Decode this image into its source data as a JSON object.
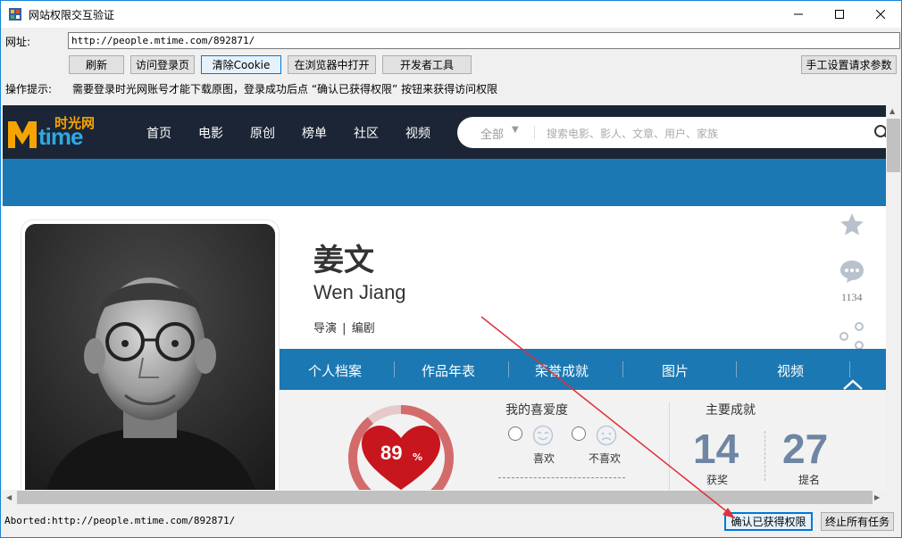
{
  "window": {
    "title": "网站权限交互验证",
    "minimize_icon": "minimize-icon",
    "maximize_icon": "maximize-icon",
    "close_icon": "close-icon"
  },
  "address": {
    "label": "网址:",
    "value": "http://people.mtime.com/892871/"
  },
  "toolbar": {
    "refresh": "刷新",
    "visit_login": "访问登录页",
    "clear_cookie": "清除Cookie",
    "open_in_browser": "在浏览器中打开",
    "dev_tools": "开发者工具",
    "manual_headers": "手工设置请求参数"
  },
  "hint": {
    "label": "操作提示:",
    "text": "需要登录时光网账号才能下载原图，登录成功后点 “确认已获得权限” 按钮来获得访问权限"
  },
  "site": {
    "logo_cn": "时光网",
    "logo_en": "time",
    "nav": [
      "首页",
      "电影",
      "原创",
      "榜单",
      "社区",
      "视频"
    ],
    "search_category": "全部",
    "search_placeholder": "搜索电影、影人、文章、用户、家族",
    "person": {
      "name_cn": "姜文",
      "name_en": "Wen Jiang",
      "role1": "导演",
      "role_sep": "|",
      "role2": "编剧"
    },
    "tabs": [
      "个人档案",
      "作品年表",
      "荣誉成就",
      "图片",
      "视频"
    ],
    "comment_count": "1134",
    "rating": {
      "percent": 89,
      "percent_label": "89",
      "percent_sign": "%"
    },
    "like": {
      "title": "我的喜爱度",
      "like": "喜欢",
      "dislike": "不喜欢"
    },
    "achievements": {
      "title": "主要成就",
      "awards_count": "14",
      "awards_label": "获奖",
      "nominations_count": "27",
      "nominations_label": "提名"
    }
  },
  "status": {
    "text": "Aborted:http://people.mtime.com/892871/",
    "confirm": "确认已获得权限",
    "stop_all": "终止所有任务"
  },
  "colors": {
    "nav_bg": "#1b2535",
    "brand_blue": "#1b78b2",
    "logo_orange": "#f7a400",
    "heart_red": "#c7161d",
    "annotation_arrow": "#e0303a"
  }
}
